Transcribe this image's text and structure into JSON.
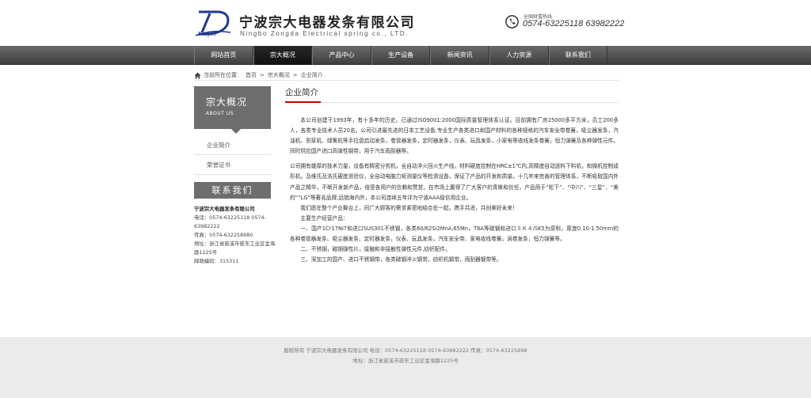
{
  "header": {
    "company_name_cn": "宁波宗大电器发条有限公司",
    "company_name_en": "Ningbo Zongda Electrical spring co., LTD.",
    "logo_script": "Zongda",
    "hotline_label": "全国财富热线",
    "hotline_numbers": "0574-63225118  63982222"
  },
  "nav": {
    "items": [
      "网站首页",
      "宗大概况",
      "产品中心",
      "生产设备",
      "新闻资讯",
      "人力资源",
      "联系我们"
    ],
    "active_index": 1
  },
  "breadcrumb": {
    "prefix": "当前所在位置：",
    "items": [
      "首页",
      "宗大概况",
      "企业简介"
    ],
    "separator": ">"
  },
  "sidebar": {
    "title_cn": "宗大概况",
    "title_en": "ABOUT US",
    "menu": [
      "企业简介",
      "荣誉证书"
    ],
    "contact_title": "联系我们",
    "contact": {
      "company": "宁波宗大电器发条有限公司",
      "tel": "电话：0574-63225118 0574-63982222",
      "fax": "传真：0574-632258980",
      "address": "地址：浙江省慈溪市慈东工业区金海路1225号",
      "postcode": "邮政编码：315311"
    }
  },
  "main": {
    "title": "企业简介",
    "paragraphs": [
      "本公司创建于1993年，有十多年的历史。已通过ISO9001:2000国际质量管理体系认证。目前拥有厂房25000多平方米，员工200多人，各类专业技术人员20名。公司引进最先进的日本工艺设备,专业生产各类进口和国产材料的各种规格的汽车安全带卷簧，吸尘器发条，汽油机、割草机、绿篱机等手拉盘启动发条，卷管器发条，定时器发条，仪表、玩具发条，小家电等收线发条卷簧，恒力弹簧及各种弹性元件。同时供应国产进口高弹性钢带，用于汽车雨刮器等。",
      "公司拥有雄厚的技术力量，设备有精密分剪机，全自动淬火回火生产线，材料硬度控制在HRC±1℃内,高精度自动送料下料机，和微机控制成形机，及维氏及洛氏硬度测验仪，全自动电脑力矩测量仪等检测设备，保证了产品的开发和质量。十几年来完善的管理体系，不断吸取国内外产品之精华，不断开发新产品，倍受各用户的信赖和赞赏，在市场上赢得了广大客户的青睐和信任，产品用于“松下”、“中川”、“三星”、“美的”“LG”等著名品牌,远销海内外，本公司连续五年评为宁波AAA级信用企业。",
      "我们愿在整个产业舞台上，同广大顾客的需求紧密地结合在一起，携手共进，共创美好未来！",
      "主要生产经营产品：",
      "一、国产1Cr17Ni7和进口SUS301不锈钢，各类60/62Si2MnA,65Mn，T8A等碳钢和进口ＳＫ４/SK5为原料，厚度0.10-1.50mm的各种卷管器发条、吸尘器发条、定时器发条，仪表、玩具发条，汽车安全带、家电收线卷簧，涡卷发条，恒力弹簧等。",
      "二、不锈钢，碳钢弹性片，接触和非接触性弹性元件,纺织配件。",
      "三、深加工的国产、进口不锈钢带，各类碳钢淬火钢带，纺织机钢带，雨刮器钢带等。"
    ]
  },
  "footer": {
    "line1": "版权所有 宁波宗大电器发条有限公司 电话：0574-63225118 0574-63982222 传真：0574-63225898",
    "line2": "地址：浙江省慈溪市慈东工业区金海路1225号"
  },
  "colors": {
    "nav_bg": "#4a4a4a",
    "sidebar_title_bg": "#6e6e6e",
    "accent_red": "#cc0000",
    "logo_blue": "#1e3a8a",
    "footer_bg": "#ebebeb"
  }
}
